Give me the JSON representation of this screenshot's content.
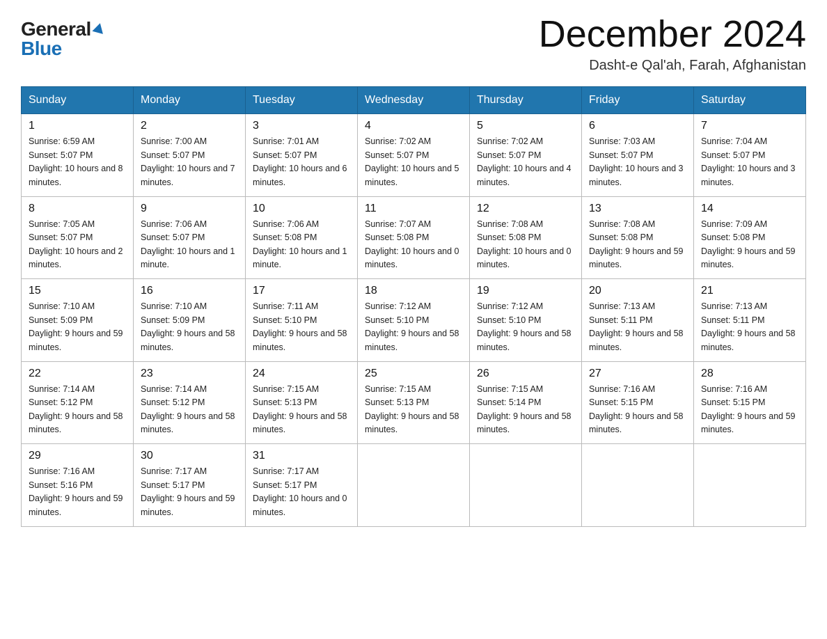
{
  "logo": {
    "general": "General",
    "blue": "Blue"
  },
  "title": "December 2024",
  "location": "Dasht-e Qal'ah, Farah, Afghanistan",
  "weekdays": [
    "Sunday",
    "Monday",
    "Tuesday",
    "Wednesday",
    "Thursday",
    "Friday",
    "Saturday"
  ],
  "weeks": [
    [
      {
        "day": "1",
        "sunrise": "6:59 AM",
        "sunset": "5:07 PM",
        "daylight": "10 hours and 8 minutes."
      },
      {
        "day": "2",
        "sunrise": "7:00 AM",
        "sunset": "5:07 PM",
        "daylight": "10 hours and 7 minutes."
      },
      {
        "day": "3",
        "sunrise": "7:01 AM",
        "sunset": "5:07 PM",
        "daylight": "10 hours and 6 minutes."
      },
      {
        "day": "4",
        "sunrise": "7:02 AM",
        "sunset": "5:07 PM",
        "daylight": "10 hours and 5 minutes."
      },
      {
        "day": "5",
        "sunrise": "7:02 AM",
        "sunset": "5:07 PM",
        "daylight": "10 hours and 4 minutes."
      },
      {
        "day": "6",
        "sunrise": "7:03 AM",
        "sunset": "5:07 PM",
        "daylight": "10 hours and 3 minutes."
      },
      {
        "day": "7",
        "sunrise": "7:04 AM",
        "sunset": "5:07 PM",
        "daylight": "10 hours and 3 minutes."
      }
    ],
    [
      {
        "day": "8",
        "sunrise": "7:05 AM",
        "sunset": "5:07 PM",
        "daylight": "10 hours and 2 minutes."
      },
      {
        "day": "9",
        "sunrise": "7:06 AM",
        "sunset": "5:07 PM",
        "daylight": "10 hours and 1 minute."
      },
      {
        "day": "10",
        "sunrise": "7:06 AM",
        "sunset": "5:08 PM",
        "daylight": "10 hours and 1 minute."
      },
      {
        "day": "11",
        "sunrise": "7:07 AM",
        "sunset": "5:08 PM",
        "daylight": "10 hours and 0 minutes."
      },
      {
        "day": "12",
        "sunrise": "7:08 AM",
        "sunset": "5:08 PM",
        "daylight": "10 hours and 0 minutes."
      },
      {
        "day": "13",
        "sunrise": "7:08 AM",
        "sunset": "5:08 PM",
        "daylight": "9 hours and 59 minutes."
      },
      {
        "day": "14",
        "sunrise": "7:09 AM",
        "sunset": "5:08 PM",
        "daylight": "9 hours and 59 minutes."
      }
    ],
    [
      {
        "day": "15",
        "sunrise": "7:10 AM",
        "sunset": "5:09 PM",
        "daylight": "9 hours and 59 minutes."
      },
      {
        "day": "16",
        "sunrise": "7:10 AM",
        "sunset": "5:09 PM",
        "daylight": "9 hours and 58 minutes."
      },
      {
        "day": "17",
        "sunrise": "7:11 AM",
        "sunset": "5:10 PM",
        "daylight": "9 hours and 58 minutes."
      },
      {
        "day": "18",
        "sunrise": "7:12 AM",
        "sunset": "5:10 PM",
        "daylight": "9 hours and 58 minutes."
      },
      {
        "day": "19",
        "sunrise": "7:12 AM",
        "sunset": "5:10 PM",
        "daylight": "9 hours and 58 minutes."
      },
      {
        "day": "20",
        "sunrise": "7:13 AM",
        "sunset": "5:11 PM",
        "daylight": "9 hours and 58 minutes."
      },
      {
        "day": "21",
        "sunrise": "7:13 AM",
        "sunset": "5:11 PM",
        "daylight": "9 hours and 58 minutes."
      }
    ],
    [
      {
        "day": "22",
        "sunrise": "7:14 AM",
        "sunset": "5:12 PM",
        "daylight": "9 hours and 58 minutes."
      },
      {
        "day": "23",
        "sunrise": "7:14 AM",
        "sunset": "5:12 PM",
        "daylight": "9 hours and 58 minutes."
      },
      {
        "day": "24",
        "sunrise": "7:15 AM",
        "sunset": "5:13 PM",
        "daylight": "9 hours and 58 minutes."
      },
      {
        "day": "25",
        "sunrise": "7:15 AM",
        "sunset": "5:13 PM",
        "daylight": "9 hours and 58 minutes."
      },
      {
        "day": "26",
        "sunrise": "7:15 AM",
        "sunset": "5:14 PM",
        "daylight": "9 hours and 58 minutes."
      },
      {
        "day": "27",
        "sunrise": "7:16 AM",
        "sunset": "5:15 PM",
        "daylight": "9 hours and 58 minutes."
      },
      {
        "day": "28",
        "sunrise": "7:16 AM",
        "sunset": "5:15 PM",
        "daylight": "9 hours and 59 minutes."
      }
    ],
    [
      {
        "day": "29",
        "sunrise": "7:16 AM",
        "sunset": "5:16 PM",
        "daylight": "9 hours and 59 minutes."
      },
      {
        "day": "30",
        "sunrise": "7:17 AM",
        "sunset": "5:17 PM",
        "daylight": "9 hours and 59 minutes."
      },
      {
        "day": "31",
        "sunrise": "7:17 AM",
        "sunset": "5:17 PM",
        "daylight": "10 hours and 0 minutes."
      },
      null,
      null,
      null,
      null
    ]
  ],
  "labels": {
    "sunrise": "Sunrise:",
    "sunset": "Sunset:",
    "daylight": "Daylight:"
  }
}
